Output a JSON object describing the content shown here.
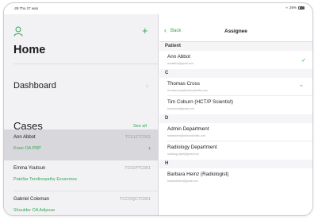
{
  "status_bar": {
    "left": "-29 Thu 27 wan",
    "right": "26%"
  },
  "home": {
    "title": "Home",
    "dashboard_label": "Dashboard",
    "cases_title": "Cases",
    "see_all": "See all",
    "cases": [
      {
        "name": "Ann Abbot",
        "id": "TC01ZTC001",
        "procedure": "Knee OA PRP",
        "selected": true
      },
      {
        "name": "Emma Youtsun",
        "id": "TC01PTC001",
        "procedure": "Patellar Tendinopathy Exosomes",
        "selected": false
      },
      {
        "name": "Gabriel Coleman",
        "id": "TCCOQCTC001",
        "procedure": "Shoulder OA Adipose",
        "selected": false
      }
    ]
  },
  "assignee": {
    "back_label": "Back",
    "title": "Assignee",
    "sections": [
      {
        "header": "Patient",
        "rows": [
          {
            "name": "Ann Abbot",
            "email": "annabbot@gmail.com",
            "role": "",
            "checked": true
          }
        ]
      },
      {
        "header": "C",
        "rows": [
          {
            "name": "Thomas Cross",
            "email": "thomascross@orthoscientific.com",
            "role": "rte",
            "checked": false
          },
          {
            "name": "Tim Coburn (HCT/P Scientist)",
            "email": "timcoburn@gmail.com",
            "role": "",
            "checked": false
          }
        ]
      },
      {
        "header": "D",
        "rows": [
          {
            "name": "Admin Department",
            "email": "hebandmin@orthoscientific.com",
            "role": "",
            "checked": false
          },
          {
            "name": "Radiology Department",
            "email": "radiology.dept@gmail.com",
            "role": "",
            "checked": false
          }
        ]
      },
      {
        "header": "H",
        "rows": [
          {
            "name": "Barbara Heinz (Radiologist)",
            "email": "barbaraheinz@gmail.com",
            "role": "",
            "checked": false
          }
        ]
      }
    ]
  },
  "colors": {
    "accent": "#34a853",
    "selected_row": "#d8d8dc",
    "left_bg": "#f2f2f4"
  }
}
